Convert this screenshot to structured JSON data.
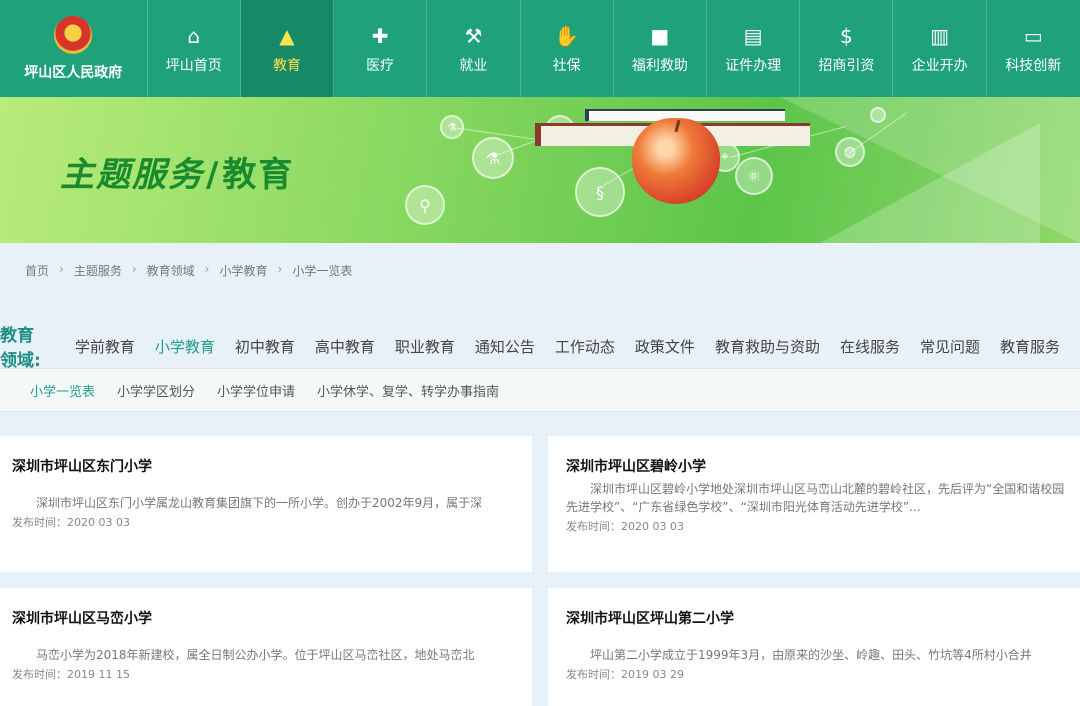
{
  "header": {
    "brand": "坪山区人民政府",
    "nav": [
      {
        "label": "坪山首页",
        "icon": "home-icon",
        "glyph": "⌂"
      },
      {
        "label": "教育",
        "icon": "graduation-cap-icon",
        "glyph": "🎓",
        "active": true
      },
      {
        "label": "医疗",
        "icon": "medical-kit-icon",
        "glyph": "✚"
      },
      {
        "label": "就业",
        "icon": "job-icon",
        "glyph": "⚒"
      },
      {
        "label": "社保",
        "icon": "handshake-icon",
        "glyph": "✋"
      },
      {
        "label": "福利救助",
        "icon": "gift-icon",
        "glyph": "🎁"
      },
      {
        "label": "证件办理",
        "icon": "id-card-icon",
        "glyph": "▤"
      },
      {
        "label": "招商引资",
        "icon": "money-bag-icon",
        "glyph": "$"
      },
      {
        "label": "企业开办",
        "icon": "building-icon",
        "glyph": "▥"
      },
      {
        "label": "科技创新",
        "icon": "laptop-icon",
        "glyph": "▭"
      }
    ]
  },
  "banner": {
    "title_part1": "主题服务",
    "title_part2": "教育"
  },
  "breadcrumb": [
    "首页",
    "主题服务",
    "教育领域",
    "小学教育",
    "小学一览表"
  ],
  "domain": {
    "title": "教育领域:",
    "items": [
      "学前教育",
      "小学教育",
      "初中教育",
      "高中教育",
      "职业教育",
      "通知公告",
      "工作动态",
      "政策文件",
      "教育救助与资助",
      "在线服务",
      "常见问题",
      "教育服务"
    ],
    "active_index": 1
  },
  "subnav": {
    "items": [
      "小学一览表",
      "小学学区划分",
      "小学学位申请",
      "小学休学、复学、转学办事指南"
    ],
    "active_index": 0
  },
  "cards": [
    {
      "title": "深圳市坪山区东门小学",
      "summary": "深圳市坪山区东门小学属龙山教育集团旗下的一所小学。创办于2002年9月，属于深",
      "date": "发布时间：2020 03 03"
    },
    {
      "title": "深圳市坪山区碧岭小学",
      "summary": "深圳市坪山区碧岭小学地处深圳市坪山区马峦山北麓的碧岭社区，先后评为“全国和谐校园先进学校”、“广东省绿色学校”、“深圳市阳光体育活动先进学校”...",
      "date": "发布时间：2020 03 03"
    },
    {
      "title": "深圳市坪山区马峦小学",
      "summary": "马峦小学为2018年新建校，属全日制公办小学。位于坪山区马峦社区，地处马峦北",
      "date": "发布时间：2019 11 15"
    },
    {
      "title": "深圳市坪山区坪山第二小学",
      "summary": "坪山第二小学成立于1999年3月，由原来的沙坐、岭趣、田头、竹坑等4所村小合并",
      "date": "发布时间：2019 03 29"
    }
  ]
}
